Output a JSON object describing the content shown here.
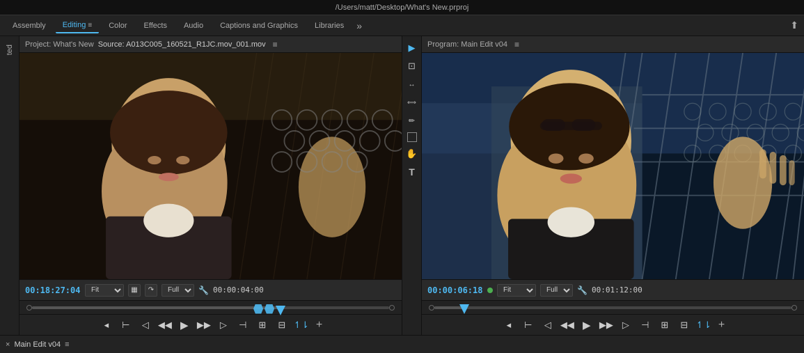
{
  "titlebar": {
    "path": "/Users/matt/Desktop/What's New.prproj"
  },
  "workspace_tabs": {
    "tabs": [
      {
        "label": "Assembly",
        "active": false
      },
      {
        "label": "Editing",
        "active": true
      },
      {
        "label": "Color",
        "active": false
      },
      {
        "label": "Effects",
        "active": false
      },
      {
        "label": "Audio",
        "active": false
      },
      {
        "label": "Captions and Graphics",
        "active": false
      },
      {
        "label": "Libraries",
        "active": false
      }
    ],
    "overflow_label": "»",
    "export_icon": "⬆"
  },
  "left_strip": {
    "label": "ted"
  },
  "source_monitor": {
    "project_label": "Project: What's New",
    "source_label": "Source: A013C005_160521_R1JC.mov_001.mov",
    "menu_icon": "≡",
    "timecode": "00:18:27:04",
    "zoom": "Fit",
    "quality": "Full",
    "end_timecode": "00:00:04:00"
  },
  "program_monitor": {
    "label": "Program: Main Edit v04",
    "menu_icon": "≡",
    "timecode": "00:00:06:18",
    "zoom": "Fit",
    "quality": "Full",
    "end_timecode": "00:01:12:00"
  },
  "tools": [
    {
      "name": "select",
      "symbol": "▶",
      "active": true
    },
    {
      "name": "track-select",
      "symbol": "⊡"
    },
    {
      "name": "ripple-edit",
      "symbol": "↔"
    },
    {
      "name": "rolling-edit",
      "symbol": "|↔|"
    },
    {
      "name": "pen",
      "symbol": "✏"
    },
    {
      "name": "rect",
      "symbol": "▭"
    },
    {
      "name": "hand",
      "symbol": "✋"
    },
    {
      "name": "text",
      "symbol": "T"
    }
  ],
  "timeline": {
    "close_icon": "×",
    "label": "Main Edit v04",
    "menu_icon": "≡"
  }
}
